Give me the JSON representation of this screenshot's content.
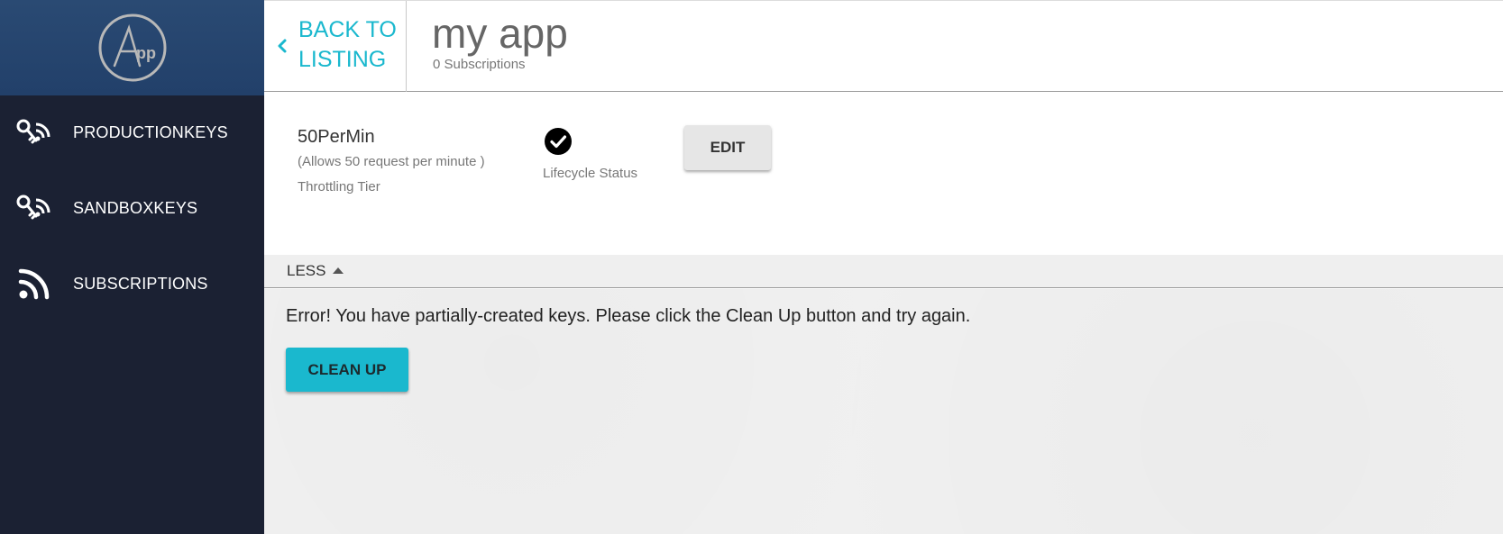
{
  "sidebar": {
    "logo_icon": "app-logo-icon",
    "items": [
      {
        "label": "PRODUCTIONKEYS",
        "icon": "key-feed-icon"
      },
      {
        "label": "SANDBOXKEYS",
        "icon": "key-feed-icon"
      },
      {
        "label": "SUBSCRIPTIONS",
        "icon": "rss-feed-icon"
      }
    ]
  },
  "header": {
    "back_label": "BACK TO LISTING",
    "back_icon": "chevron-left-icon",
    "title": "my app",
    "subscriptions": "0 Subscriptions"
  },
  "info": {
    "tier_name": "50PerMin",
    "tier_desc": "(Allows 50 request per minute )",
    "tier_label": "Throttling Tier",
    "status_icon": "check-circle-icon",
    "status_label": "Lifecycle Status",
    "edit_label": "EDIT"
  },
  "less_bar": {
    "label": "LESS",
    "icon": "caret-up-icon"
  },
  "content": {
    "error_message": "Error! You have partially-created keys. Please click the Clean Up button and try again.",
    "cleanup_label": "CLEAN UP"
  },
  "colors": {
    "accent": "#1ab8ce",
    "sidebar_bg": "#1b2133",
    "logo_bg": "#2a4a73"
  }
}
